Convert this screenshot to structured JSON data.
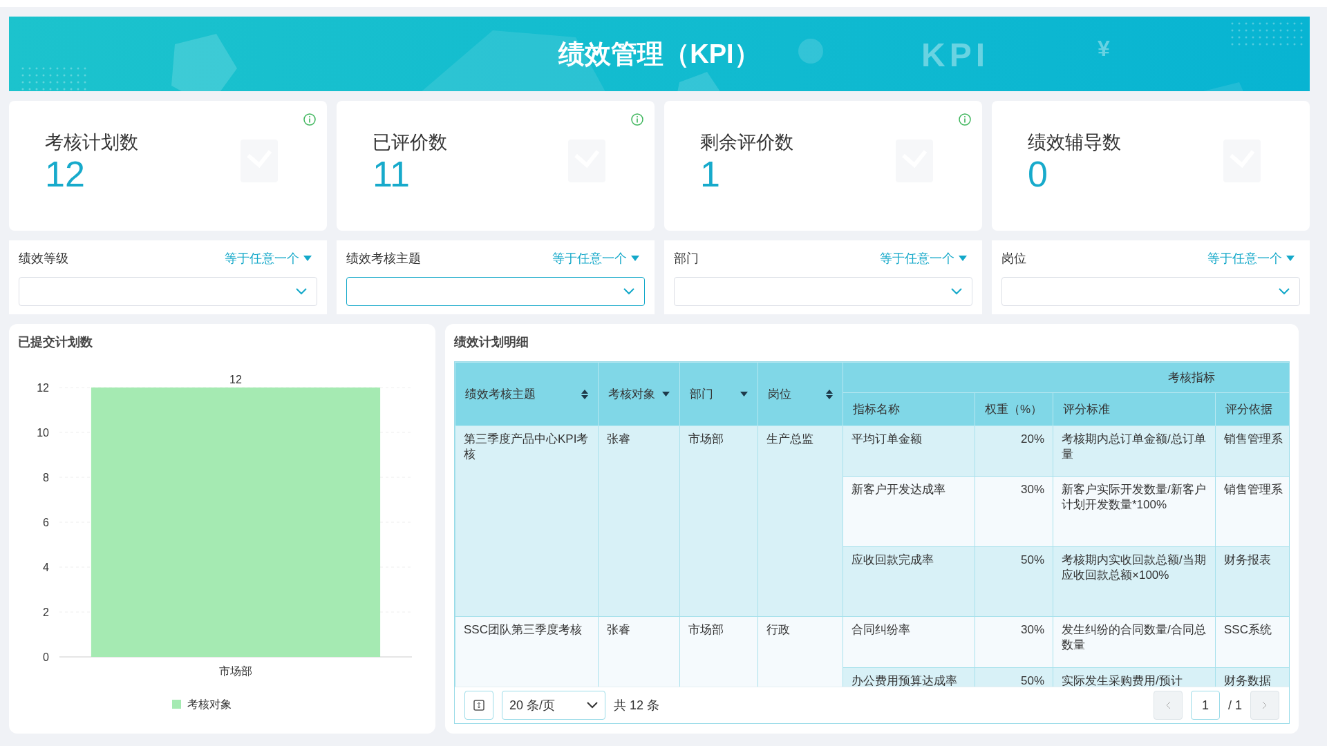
{
  "banner": {
    "title": "绩效管理（KPI）",
    "decor_labels": [
      "KPI",
      "¥"
    ]
  },
  "stats": [
    {
      "label": "考核计划数",
      "value": "12",
      "info": true
    },
    {
      "label": "已评价数",
      "value": "11",
      "info": true
    },
    {
      "label": "剩余评价数",
      "value": "1",
      "info": true
    },
    {
      "label": "绩效辅导数",
      "value": "0",
      "info": false
    }
  ],
  "filters": [
    {
      "label": "绩效等级",
      "operator": "等于任意一个",
      "focused": false
    },
    {
      "label": "绩效考核主题",
      "operator": "等于任意一个",
      "focused": true
    },
    {
      "label": "部门",
      "operator": "等于任意一个",
      "focused": false
    },
    {
      "label": "岗位",
      "operator": "等于任意一个",
      "focused": false
    }
  ],
  "chart_panel": {
    "title": "已提交计划数",
    "chart_data": {
      "type": "bar",
      "categories": [
        "市场部"
      ],
      "series": [
        {
          "name": "考核对象",
          "color": "#a5eab2",
          "values": [
            12
          ]
        }
      ],
      "ylim": [
        0,
        12
      ],
      "grid": true,
      "yticks": [
        0,
        2,
        4,
        6,
        8,
        10,
        12
      ],
      "data_labels": true
    }
  },
  "table_panel": {
    "title": "绩效计划明细",
    "columns": [
      {
        "label": "绩效考核主题",
        "kind": "sort"
      },
      {
        "label": "考核对象",
        "kind": "filter"
      },
      {
        "label": "部门",
        "kind": "filter"
      },
      {
        "label": "岗位",
        "kind": "sort"
      }
    ],
    "group_header": "考核指标",
    "sub_columns": [
      "指标名称",
      "权重（%）",
      "评分标准",
      "评分依据"
    ],
    "rows": [
      {
        "theme": "第三季度产品中心KPI考核",
        "person": "张睿",
        "department": "市场部",
        "position": "生产总监",
        "indicators": [
          {
            "name": "平均订单金额",
            "weight": "20%",
            "standard": "考核期内总订单金额/总订单量",
            "basis": "销售管理系"
          },
          {
            "name": "新客户开发达成率",
            "weight": "30%",
            "standard": "新客户实际开发数量/新客户计划开发数量*100%",
            "basis": "销售管理系"
          },
          {
            "name": "应收回款完成率",
            "weight": "50%",
            "standard": "考核期内实收回款总额/当期应收回款总额×100%",
            "basis": "财务报表"
          }
        ]
      },
      {
        "theme": "SSC团队第三季度考核",
        "person": "张睿",
        "department": "市场部",
        "position": "行政",
        "indicators": [
          {
            "name": "合同纠纷率",
            "weight": "30%",
            "standard": "发生纠纷的合同数量/合同总数量",
            "basis": "SSC系统"
          },
          {
            "name": "办公费用预算达成率",
            "weight": "50%",
            "standard": "实际发生采购费用/预计",
            "basis": "财务数据"
          }
        ]
      }
    ],
    "pagination": {
      "page_size": "20 条/页",
      "total": "共 12 条",
      "page": "1",
      "pages": "/ 1"
    }
  }
}
